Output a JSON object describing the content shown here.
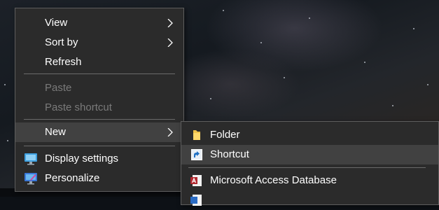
{
  "context_menu": {
    "items": [
      {
        "label": "View",
        "has_submenu": true,
        "enabled": true
      },
      {
        "label": "Sort by",
        "has_submenu": true,
        "enabled": true
      },
      {
        "label": "Refresh",
        "has_submenu": false,
        "enabled": true
      },
      {
        "label": "Paste",
        "has_submenu": false,
        "enabled": false
      },
      {
        "label": "Paste shortcut",
        "has_submenu": false,
        "enabled": false
      },
      {
        "label": "New",
        "has_submenu": true,
        "enabled": true,
        "highlighted": true
      },
      {
        "label": "Display settings",
        "icon": "display-settings-icon",
        "enabled": true
      },
      {
        "label": "Personalize",
        "icon": "personalize-icon",
        "enabled": true
      }
    ]
  },
  "new_submenu": {
    "items": [
      {
        "label": "Folder",
        "icon": "folder-icon"
      },
      {
        "label": "Shortcut",
        "icon": "shortcut-icon",
        "highlighted": true
      },
      {
        "label": "Microsoft Access Database",
        "icon": "access-database-icon"
      }
    ]
  },
  "colors": {
    "menu_bg": "#2b2b2b",
    "menu_border": "#5e5e5e",
    "highlight_bg": "#414141",
    "text": "#ffffff",
    "disabled_text": "#7a7a7a"
  }
}
